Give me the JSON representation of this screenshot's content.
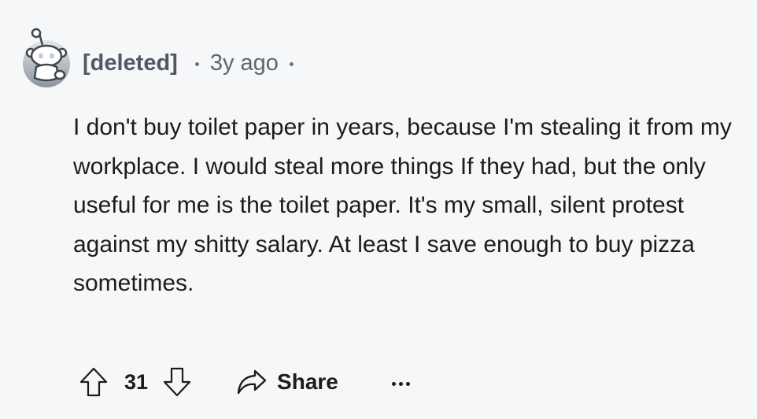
{
  "comment": {
    "author": "[deleted]",
    "timestamp": "3y ago",
    "avatar_icon": "snoo-avatar-icon",
    "text": "I don't buy toilet paper in years, because I'm stealing it from my workplace. I would steal more things If they had, but the only useful for me is the toilet paper. It's my small, silent protest against my shitty salary. At least I save enough to buy pizza sometimes."
  },
  "actions": {
    "score": "31",
    "upvote_icon": "upvote-arrow-icon",
    "downvote_icon": "downvote-arrow-icon",
    "share_label": "Share",
    "share_icon": "share-arrow-icon",
    "more_icon": "more-options-icon"
  },
  "colors": {
    "background": "#f6f7f8",
    "text": "#1c1c1c",
    "meta": "#5c6670"
  }
}
